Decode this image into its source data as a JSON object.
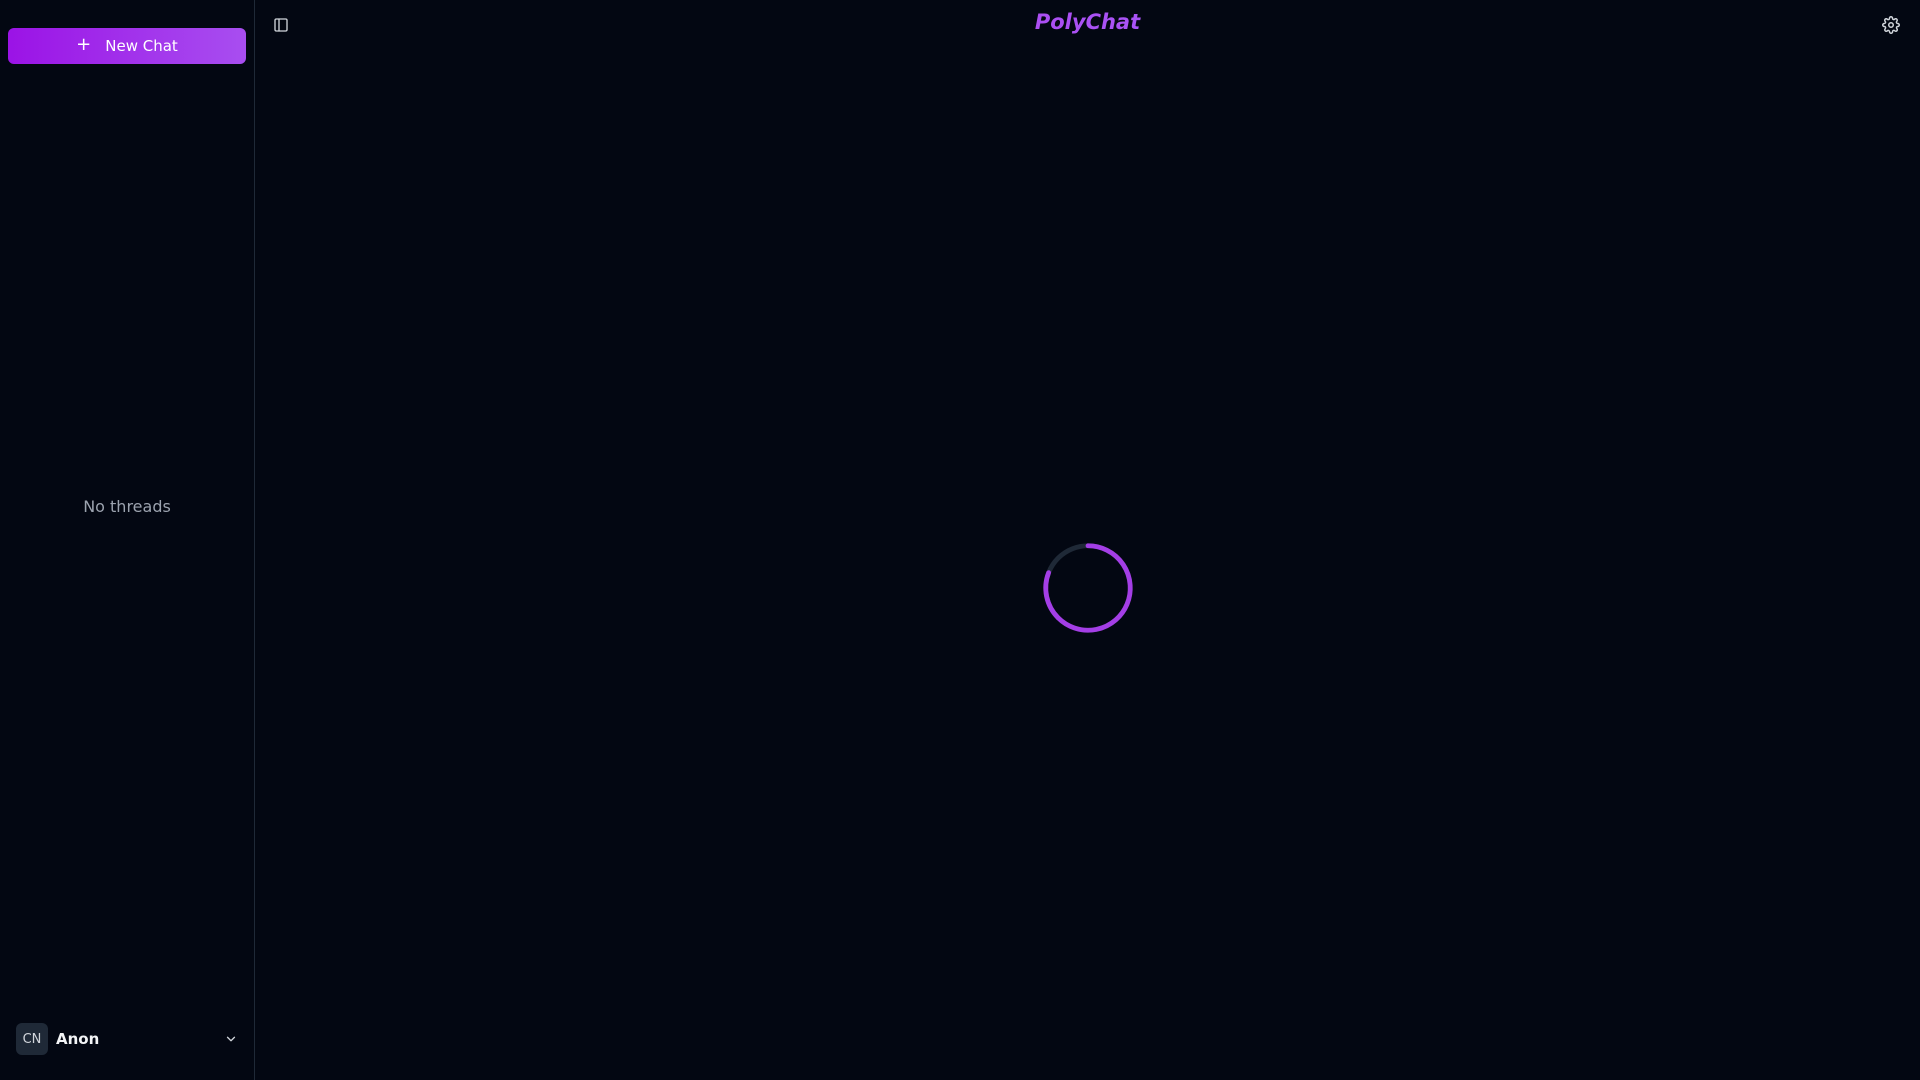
{
  "app": {
    "title": "PolyChat"
  },
  "sidebar": {
    "new_chat_label": "New Chat",
    "empty_label": "No threads",
    "user": {
      "initials": "CN",
      "name": "Anon"
    }
  },
  "colors": {
    "background": "#030712",
    "accent": "#9b13e6",
    "accent_light": "#a855f7"
  },
  "icons": {
    "new_chat": "plus-icon",
    "sidebar_toggle": "panel-left-icon",
    "settings": "gear-icon",
    "user_menu": "chevron-down-icon",
    "loading": "spinner-icon"
  }
}
